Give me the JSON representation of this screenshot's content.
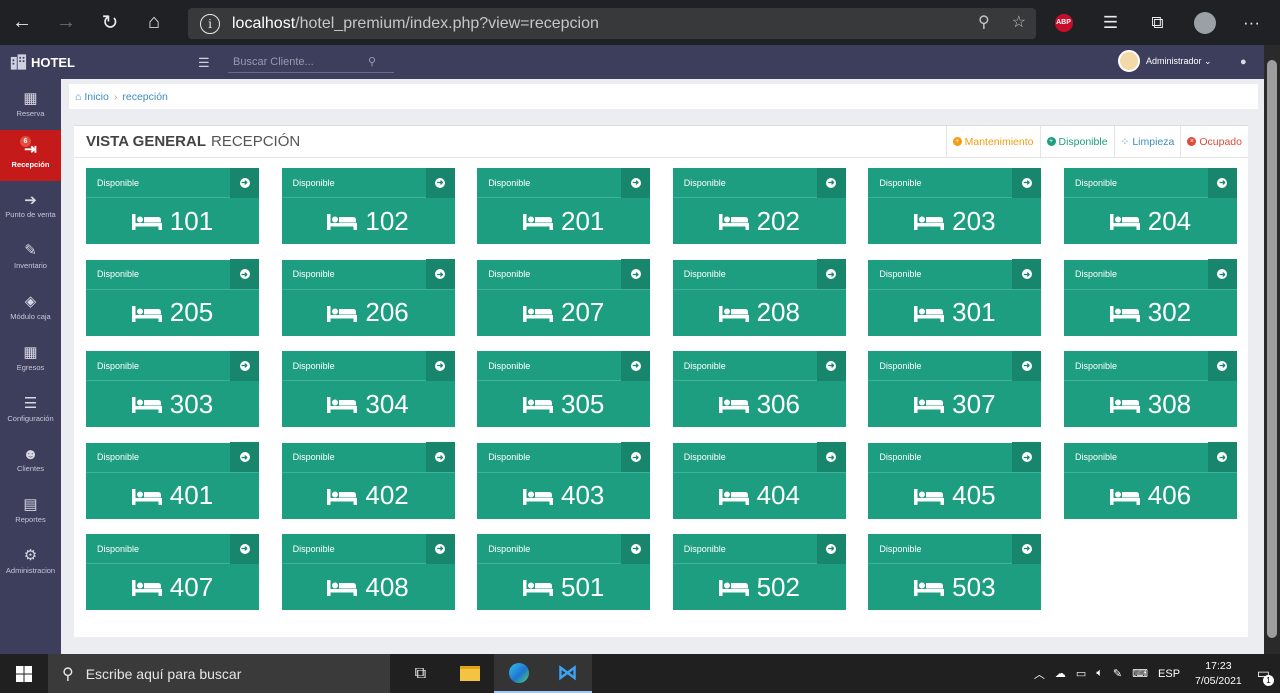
{
  "browser": {
    "url_host": "localhost",
    "url_path": "/hotel_premium/index.php?view=recepcion",
    "abp_label": "ABP"
  },
  "header": {
    "brand": "HOTEL",
    "search_placeholder": "Buscar Cliente...",
    "user_name": "Administrador ⌄"
  },
  "sidebar": {
    "items": [
      {
        "label": "Reserva",
        "icon": "calendar-icon"
      },
      {
        "label": "Recepción",
        "icon": "sign-in-icon",
        "badge": "6"
      },
      {
        "label": "Punto de venta",
        "icon": "arrow-circle-icon"
      },
      {
        "label": "Inventario",
        "icon": "edit-icon"
      },
      {
        "label": "Módulo caja",
        "icon": "cube-icon"
      },
      {
        "label": "Egresos",
        "icon": "table-icon"
      },
      {
        "label": "Configuración",
        "icon": "database-icon"
      },
      {
        "label": "Clientes",
        "icon": "users-icon"
      },
      {
        "label": "Reportes",
        "icon": "file-icon"
      },
      {
        "label": "Administracion",
        "icon": "cog-icon"
      }
    ]
  },
  "breadcrumb": {
    "home": "Inicio",
    "current": "recepción"
  },
  "panel": {
    "title_bold": "VISTA GENERAL",
    "title_rest": "RECEPCIÓN",
    "legend": [
      {
        "label": "Mantenimiento",
        "color": "#f39c12"
      },
      {
        "label": "Disponible",
        "color": "#1d9e80"
      },
      {
        "label": "Limpieza",
        "color": "#3c8dbc"
      },
      {
        "label": "Ocupado",
        "color": "#dd4b39"
      }
    ]
  },
  "rooms": [
    {
      "status": "Disponible",
      "number": "101"
    },
    {
      "status": "Disponible",
      "number": "102"
    },
    {
      "status": "Disponible",
      "number": "201"
    },
    {
      "status": "Disponible",
      "number": "202"
    },
    {
      "status": "Disponible",
      "number": "203"
    },
    {
      "status": "Disponible",
      "number": "204"
    },
    {
      "status": "Disponible",
      "number": "205"
    },
    {
      "status": "Disponible",
      "number": "206"
    },
    {
      "status": "Disponible",
      "number": "207"
    },
    {
      "status": "Disponible",
      "number": "208"
    },
    {
      "status": "Disponible",
      "number": "301"
    },
    {
      "status": "Disponible",
      "number": "302"
    },
    {
      "status": "Disponible",
      "number": "303"
    },
    {
      "status": "Disponible",
      "number": "304"
    },
    {
      "status": "Disponible",
      "number": "305"
    },
    {
      "status": "Disponible",
      "number": "306"
    },
    {
      "status": "Disponible",
      "number": "307"
    },
    {
      "status": "Disponible",
      "number": "308"
    },
    {
      "status": "Disponible",
      "number": "401"
    },
    {
      "status": "Disponible",
      "number": "402"
    },
    {
      "status": "Disponible",
      "number": "403"
    },
    {
      "status": "Disponible",
      "number": "404"
    },
    {
      "status": "Disponible",
      "number": "405"
    },
    {
      "status": "Disponible",
      "number": "406"
    },
    {
      "status": "Disponible",
      "number": "407"
    },
    {
      "status": "Disponible",
      "number": "408"
    },
    {
      "status": "Disponible",
      "number": "501"
    },
    {
      "status": "Disponible",
      "number": "502"
    },
    {
      "status": "Disponible",
      "number": "503"
    }
  ],
  "taskbar": {
    "search_text": "Escribe aquí para buscar",
    "language": "ESP",
    "time": "17:23",
    "date": "7/05/2021",
    "notification_count": "1"
  }
}
